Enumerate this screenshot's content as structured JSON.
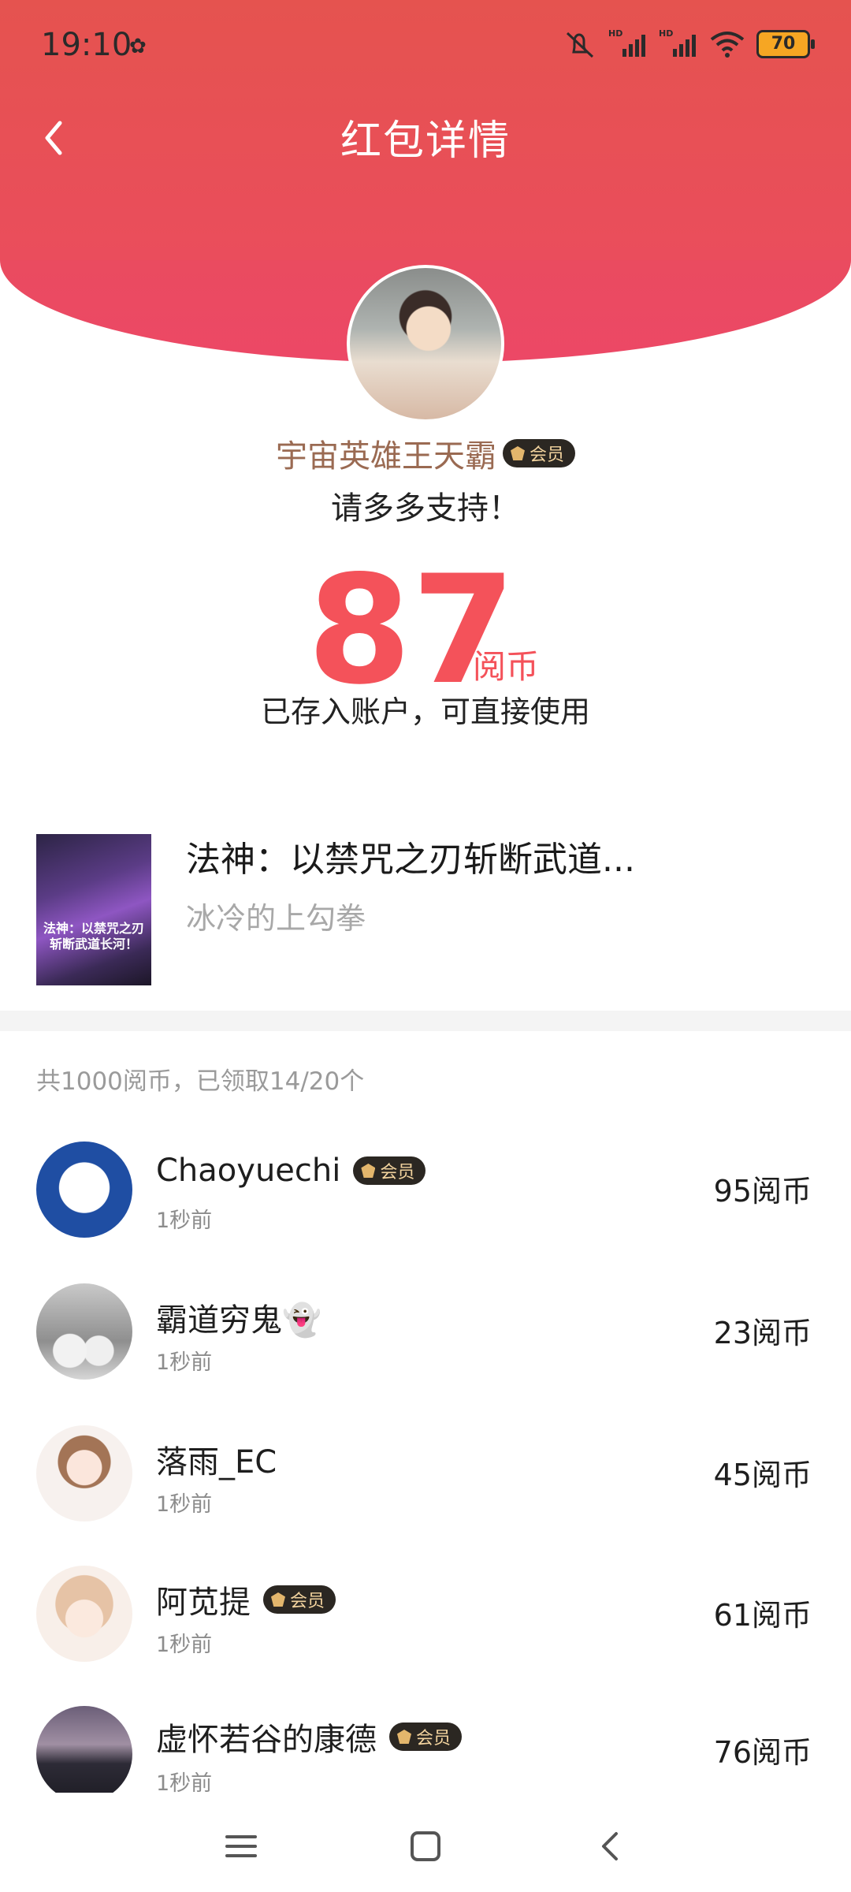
{
  "status_bar": {
    "time": "19:10",
    "battery": "70"
  },
  "header": {
    "title": "红包详情"
  },
  "sender": {
    "name": "宇宙英雄王天霸",
    "badge": "会员",
    "message": "请多多支持！",
    "amount": "87",
    "unit": "阅币",
    "note": "已存入账户，可直接使用"
  },
  "book": {
    "title": "法神：以禁咒之刃斩断武道...",
    "author": "冰冷的上勾拳",
    "cover_text": "法神：以禁咒之刃斩断武道长河！"
  },
  "summary": "共1000阅币，已领取14/20个",
  "recipients": [
    {
      "name": "Chaoyuechi",
      "badge": "会员",
      "time": "1秒前",
      "coins": "95阅币"
    },
    {
      "name": "霸道穷鬼👻",
      "time": "1秒前",
      "coins": "23阅币"
    },
    {
      "name": "落雨_EC",
      "time": "1秒前",
      "coins": "45阅币"
    },
    {
      "name": "阿苋提",
      "badge": "会员",
      "time": "1秒前",
      "coins": "61阅币"
    },
    {
      "name": "虚怀若谷的康德",
      "badge": "会员",
      "time": "1秒前",
      "coins": "76阅币"
    }
  ],
  "colors": {
    "header": "#e5534f",
    "amount": "#f4525a",
    "badge_bg": "#2b2722",
    "badge_text": "#f2d39e"
  },
  "icons": {
    "back": "chevron-left-icon",
    "nav": [
      "menu-icon",
      "home-square-icon",
      "back-triangle-icon"
    ]
  }
}
